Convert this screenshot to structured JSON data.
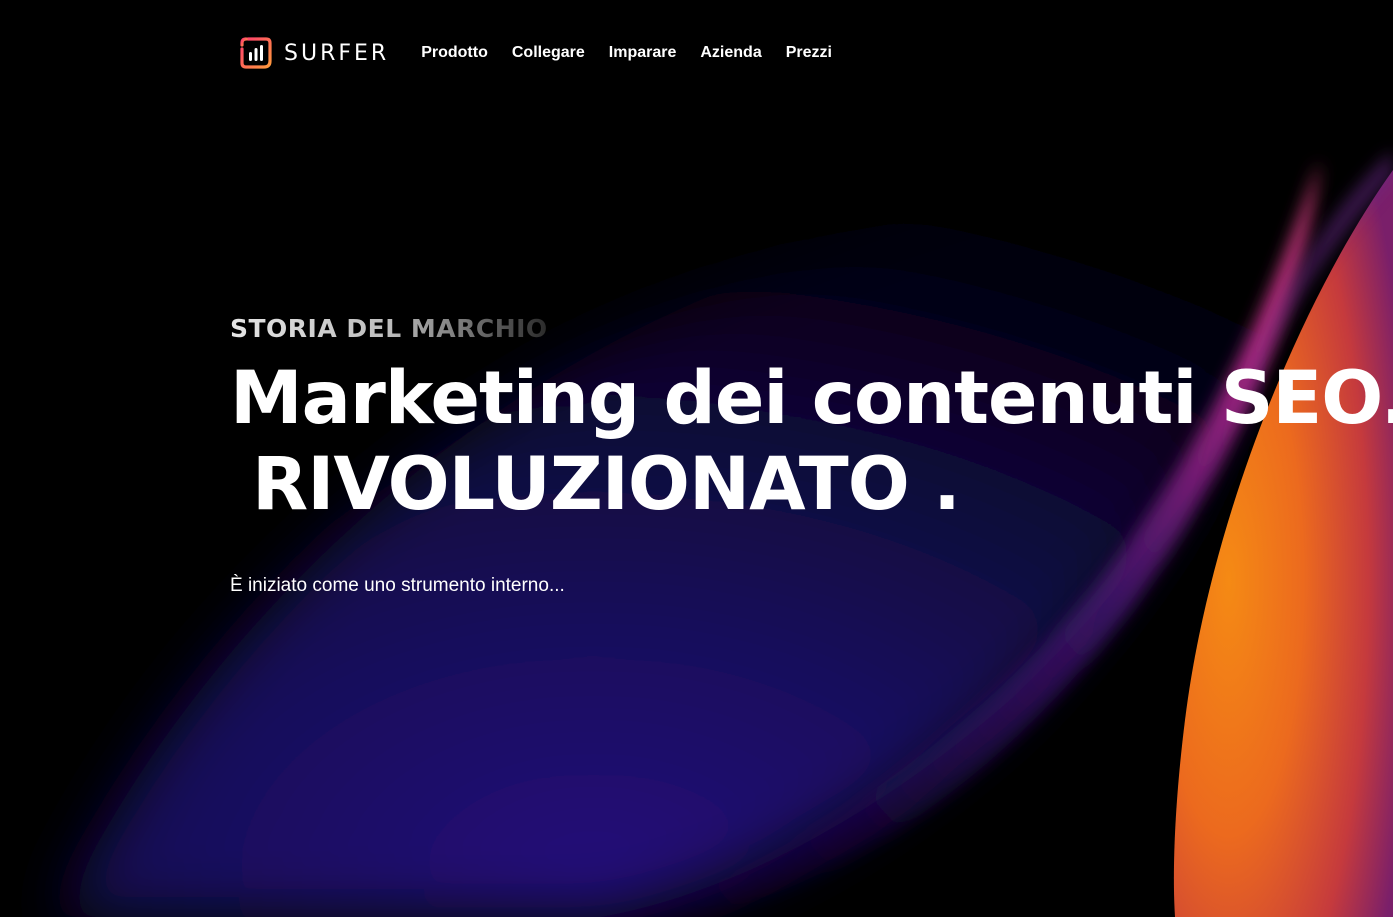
{
  "header": {
    "logo_text": "SURFER",
    "nav": [
      {
        "label": "Prodotto"
      },
      {
        "label": "Collegare"
      },
      {
        "label": "Imparare"
      },
      {
        "label": "Azienda"
      },
      {
        "label": "Prezzi"
      }
    ]
  },
  "hero": {
    "eyebrow": "STORIA DEL MARCHIO",
    "headline_line1": "Marketing dei contenuti SEO.",
    "headline_line2": "RIVOLUZIONATO .",
    "subtext": "È iniziato come uno strumento interno..."
  },
  "colors": {
    "background": "#000000",
    "accent_orange": "#f07b1c",
    "accent_magenta": "#c02a8a",
    "accent_indigo": "#1a0f66",
    "text": "#ffffff"
  },
  "icons": {
    "logo": "surfer-logo-icon"
  }
}
